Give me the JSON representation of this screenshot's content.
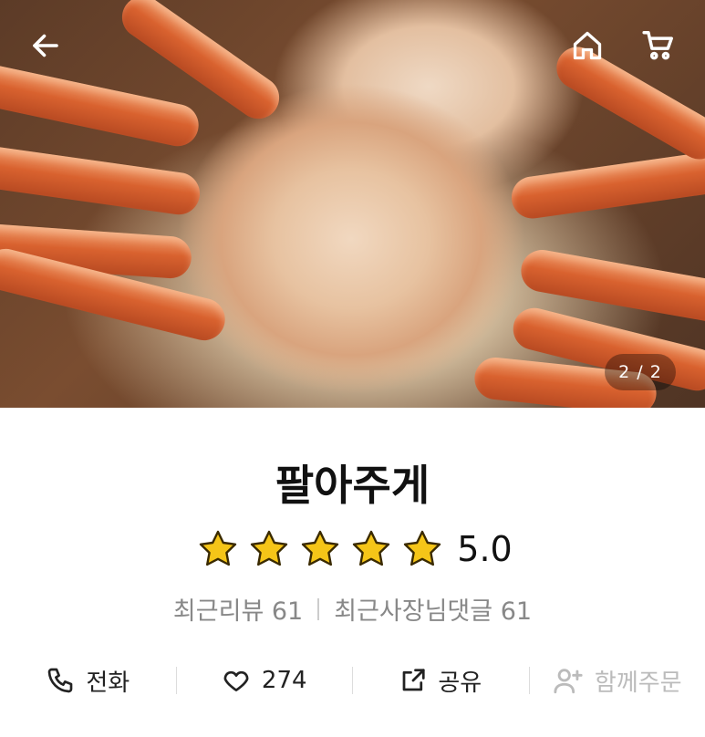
{
  "hero": {
    "image_counter": "2 / 2"
  },
  "header": {
    "back_icon": "arrow-left-icon",
    "home_icon": "home-icon",
    "cart_icon": "cart-icon"
  },
  "store": {
    "name": "팔아주게",
    "rating": "5.0",
    "stars_filled": 5,
    "recent_reviews": "최근리뷰 61",
    "recent_owner_comments": "최근사장님댓글 61"
  },
  "actions": {
    "call_label": "전화",
    "like_count": "274",
    "share_label": "공유",
    "group_order_label": "함께주문"
  },
  "colors": {
    "star_fill": "#f5c518",
    "star_stroke": "#3a2a00",
    "disabled_text": "#bbbbbb"
  }
}
